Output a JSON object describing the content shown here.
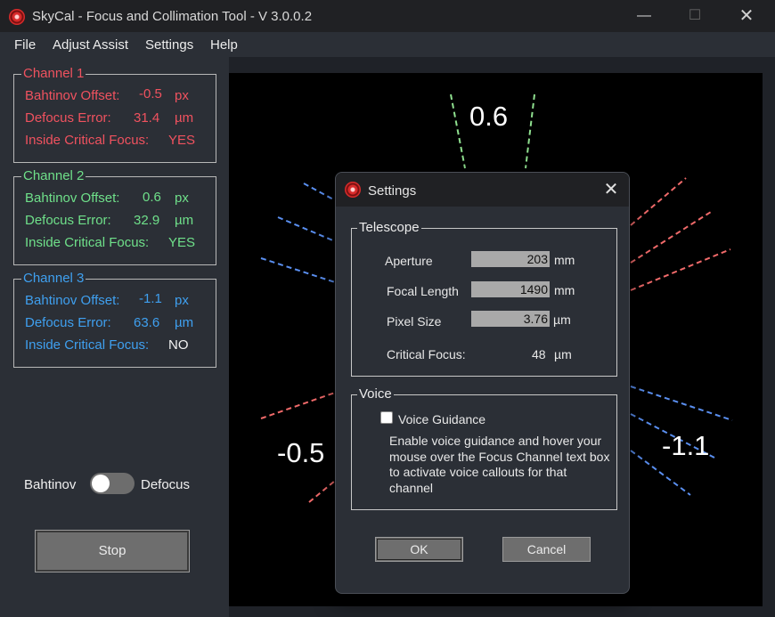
{
  "window": {
    "title": "SkyCal - Focus and Collimation Tool - V 3.0.0.2",
    "min": "—",
    "max": "☐",
    "close": "✕"
  },
  "menu": {
    "file": "File",
    "adjust": "Adjust Assist",
    "settings": "Settings",
    "help": "Help"
  },
  "channels": [
    {
      "label": "Channel 1",
      "offset_label": "Bahtinov Offset:",
      "offset": "-0.5",
      "offset_unit": "px",
      "defocus_label": "Defocus Error:",
      "defocus": "31.4",
      "defocus_unit": "µm",
      "critical_label": "Inside Critical Focus:",
      "critical": "YES",
      "color": "#f0525f"
    },
    {
      "label": "Channel 2",
      "offset_label": "Bahtinov Offset:",
      "offset": "0.6",
      "offset_unit": "px",
      "defocus_label": "Defocus Error:",
      "defocus": "32.9",
      "defocus_unit": "µm",
      "critical_label": "Inside Critical Focus:",
      "critical": "YES",
      "color": "#6fe08a"
    },
    {
      "label": "Channel 3",
      "offset_label": "Bahtinov Offset:",
      "offset": "-1.1",
      "offset_unit": "px",
      "defocus_label": "Defocus Error:",
      "defocus": "63.6",
      "defocus_unit": "µm",
      "critical_label": "Inside Critical Focus:",
      "critical": "NO",
      "color": "#3fa0f0"
    }
  ],
  "mode": {
    "left": "Bahtinov",
    "right": "Defocus",
    "state": "Bahtinov"
  },
  "stop_label": "Stop",
  "canvas": {
    "top_value": "0.6",
    "left_value": "-0.5",
    "right_value": "-1.1"
  },
  "dialog": {
    "title": "Settings",
    "close": "✕",
    "telescope": {
      "label": "Telescope",
      "aperture_label": "Aperture",
      "aperture": "203",
      "aperture_unit": "mm",
      "focal_label": "Focal Length",
      "focal": "1490",
      "focal_unit": "mm",
      "pixel_label": "Pixel Size",
      "pixel": "3.76",
      "pixel_unit": "µm",
      "critical_label": "Critical Focus:",
      "critical": "48",
      "critical_unit": "µm"
    },
    "voice": {
      "label": "Voice",
      "checkbox_label": "Voice Guidance",
      "checked": false,
      "description": "Enable voice guidance and hover your mouse over the Focus Channel text box to activate voice callouts for that channel"
    },
    "ok": "OK",
    "cancel": "Cancel"
  }
}
